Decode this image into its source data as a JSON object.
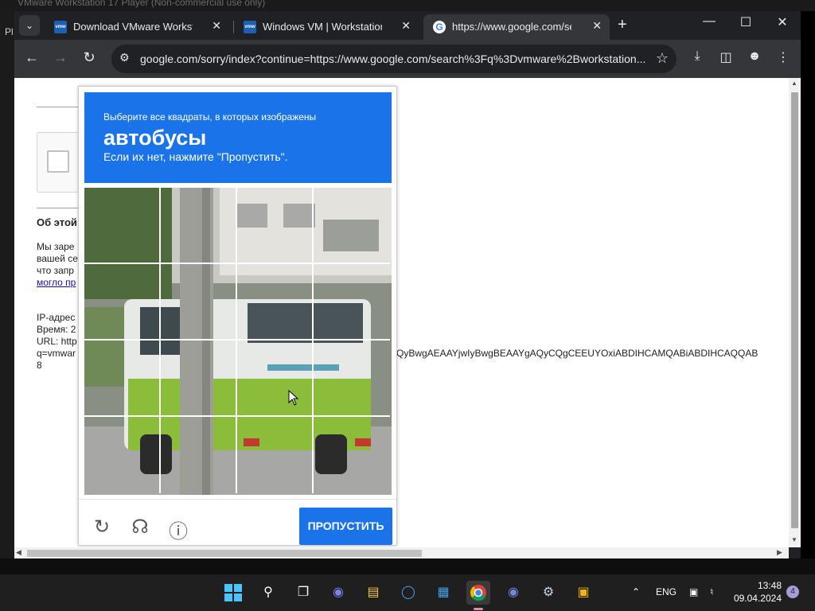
{
  "host": {
    "window_title": "VMware Workstation 17 Player (Non-commercial use only)",
    "side_label": "Pl"
  },
  "browser": {
    "tabs": [
      {
        "title": "Download VMware Workstation",
        "active": false
      },
      {
        "title": "Windows VM | Workstation Pro",
        "active": false
      },
      {
        "title": "https://www.google.com/search",
        "active": true
      }
    ],
    "url": "google.com/sorry/index?continue=https://www.google.com/search%3Fq%3Dvmware%2Bworkstation..."
  },
  "background_page": {
    "heading": "Об этой",
    "para": [
      "Мы заре",
      "вашей се",
      "что запр"
    ],
    "link": "могло пр",
    "info": [
      "IP-адрес",
      "Время: 2",
      "URL: http",
      "q=vmwar",
      "8"
    ],
    "long_text": "QyBwgAEAAYjwIyBwgBEAAYgAQyCQgCEEUYOxiABDIHCAMQABiABDIHCAQQAB"
  },
  "captcha": {
    "instruction": "Выберите все квадраты, в которых изображены",
    "target": "автобусы",
    "hint": "Если их нет, нажмите \"Пропустить\".",
    "skip_label": "ПРОПУСТИТЬ",
    "accent": "#1a73e8"
  },
  "taskbar": {
    "language": "ENG",
    "time": "13:48",
    "date": "09.04.2024",
    "notifications": "4"
  }
}
